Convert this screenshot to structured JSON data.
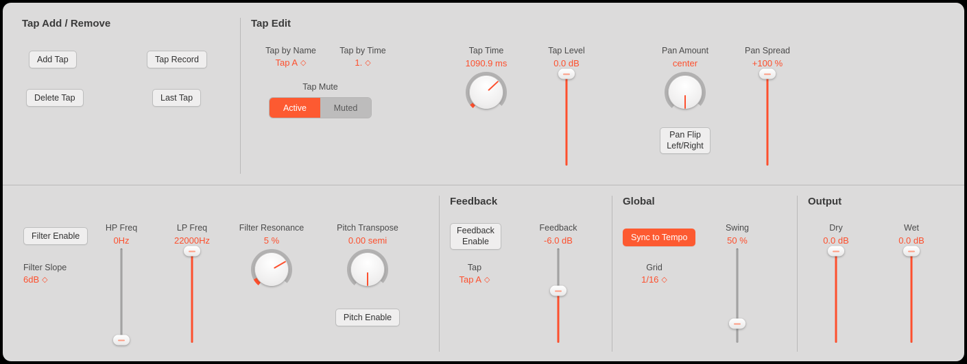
{
  "tap_add": {
    "title": "Tap Add / Remove",
    "add": "Add Tap",
    "record": "Tap Record",
    "delete": "Delete Tap",
    "last": "Last Tap"
  },
  "tap_edit": {
    "title": "Tap Edit",
    "by_name_lbl": "Tap by Name",
    "by_name_val": "Tap A",
    "by_time_lbl": "Tap by Time",
    "by_time_val": "1.",
    "mute_lbl": "Tap Mute",
    "mute_active": "Active",
    "mute_muted": "Muted",
    "time_lbl": "Tap Time",
    "time_val": "1090.9 ms",
    "level_lbl": "Tap Level",
    "level_val": "0.0 dB",
    "pan_amt_lbl": "Pan Amount",
    "pan_amt_val": "center",
    "pan_flip1": "Pan Flip",
    "pan_flip2": "Left/Right",
    "pan_spread_lbl": "Pan Spread",
    "pan_spread_val": "+100 %"
  },
  "filter": {
    "enable": "Filter Enable",
    "slope_lbl": "Filter Slope",
    "slope_val": "6dB",
    "hp_lbl": "HP Freq",
    "hp_val": "0Hz",
    "lp_lbl": "LP Freq",
    "lp_val": "22000Hz",
    "res_lbl": "Filter Resonance",
    "res_val": "5 %",
    "pitch_lbl": "Pitch Transpose",
    "pitch_val": "0.00 semi",
    "pitch_enable": "Pitch Enable"
  },
  "feedback": {
    "title": "Feedback",
    "enable1": "Feedback",
    "enable2": "Enable",
    "tap_lbl": "Tap",
    "tap_val": "Tap A",
    "fb_lbl": "Feedback",
    "fb_val": "-6.0 dB"
  },
  "global": {
    "title": "Global",
    "sync": "Sync to Tempo",
    "grid_lbl": "Grid",
    "grid_val": "1/16",
    "swing_lbl": "Swing",
    "swing_val": "50 %"
  },
  "output": {
    "title": "Output",
    "dry_lbl": "Dry",
    "dry_val": "0.0 dB",
    "wet_lbl": "Wet",
    "wet_val": "0.0 dB"
  },
  "chart_data": {
    "controls": [
      {
        "id": "tap_time",
        "type": "knob",
        "angle_deg": -133,
        "value": 1090.9,
        "unit": "ms"
      },
      {
        "id": "tap_level",
        "type": "vslider",
        "norm": 1.0,
        "value": 0.0,
        "unit": "dB"
      },
      {
        "id": "pan_amount",
        "type": "knob",
        "angle_deg": 0,
        "value": "center"
      },
      {
        "id": "pan_spread",
        "type": "vslider",
        "norm": 1.0,
        "value": 100,
        "unit": "%"
      },
      {
        "id": "hp_freq",
        "type": "vslider",
        "norm": 0.0,
        "value": 0,
        "unit": "Hz"
      },
      {
        "id": "lp_freq",
        "type": "vslider",
        "norm": 1.0,
        "value": 22000,
        "unit": "Hz"
      },
      {
        "id": "filter_resonance",
        "type": "knob",
        "angle_deg": -120,
        "value": 5,
        "unit": "%"
      },
      {
        "id": "pitch_transpose",
        "type": "knob",
        "angle_deg": 0,
        "value": 0.0,
        "unit": "semi"
      },
      {
        "id": "feedback",
        "type": "vslider",
        "norm": 0.55,
        "value": -6.0,
        "unit": "dB"
      },
      {
        "id": "swing",
        "type": "vslider",
        "norm": 0.2,
        "value": 50,
        "unit": "%"
      },
      {
        "id": "dry",
        "type": "vslider",
        "norm": 1.0,
        "value": 0.0,
        "unit": "dB"
      },
      {
        "id": "wet",
        "type": "vslider",
        "norm": 1.0,
        "value": 0.0,
        "unit": "dB"
      }
    ]
  }
}
